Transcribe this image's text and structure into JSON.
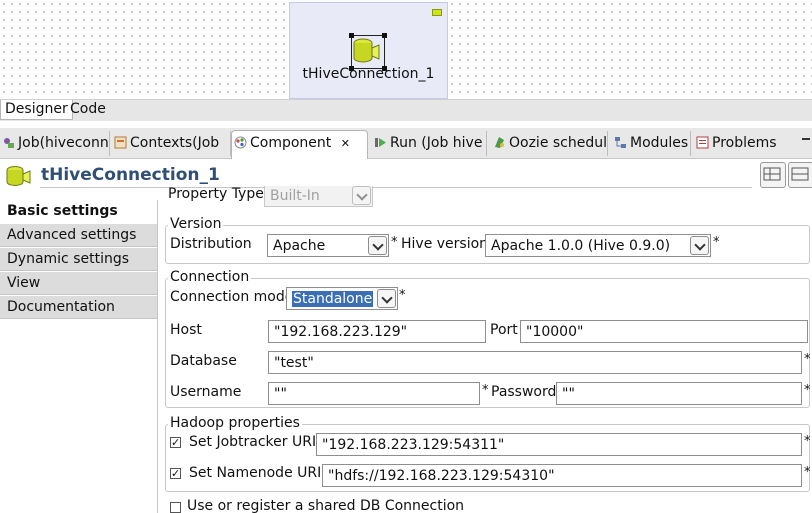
{
  "designer": {
    "component_label": "tHiveConnection_1",
    "tabs": [
      "Designer",
      "Code"
    ]
  },
  "views": {
    "tabs": [
      {
        "label": "Job(hiveconn",
        "icon": "job-icon"
      },
      {
        "label": "Contexts(Job",
        "icon": "contexts-icon"
      },
      {
        "label": "Component",
        "icon": "component-icon",
        "close": "✕"
      },
      {
        "label": "Run (Job hive",
        "icon": "run-icon"
      },
      {
        "label": "Oozie schedul",
        "icon": "oozie-icon"
      },
      {
        "label": "Modules",
        "icon": "modules-icon"
      },
      {
        "label": "Problems",
        "icon": "problems-icon"
      }
    ]
  },
  "component": {
    "title": "tHiveConnection_1"
  },
  "nav": {
    "items": [
      "Basic settings",
      "Advanced settings",
      "Dynamic settings",
      "View",
      "Documentation"
    ]
  },
  "form": {
    "property_type": {
      "label": "Property Type",
      "value": "Built-In"
    },
    "version": {
      "legend": "Version",
      "distribution_label": "Distribution",
      "distribution_value": "Apache",
      "hive_version_label": "Hive version",
      "hive_version_value": "Apache 1.0.0 (Hive 0.9.0)"
    },
    "connection": {
      "legend": "Connection",
      "mode_label": "Connection mode",
      "mode_value": "Standalone",
      "host_label": "Host",
      "host_value": "\"192.168.223.129\"",
      "port_label": "Port",
      "port_value": "\"10000\"",
      "database_label": "Database",
      "database_value": "\"test\"",
      "username_label": "Username",
      "username_value": "\"\"",
      "password_label": "Password",
      "password_value": "\"\""
    },
    "hadoop": {
      "legend": "Hadoop properties",
      "jobtracker_label": "Set Jobtracker URI",
      "jobtracker_value": "\"192.168.223.129:54311\"",
      "namenode_label": "Set Namenode URI",
      "namenode_value": "\"hdfs://192.168.223.129:54310\""
    },
    "shared_db_label": "Use or register a shared DB Connection",
    "required_mark": "*"
  },
  "colors": {
    "title_blue": "#2f4f75",
    "selection": "#3a6fb5",
    "component_yellow": "#cfe21a"
  }
}
